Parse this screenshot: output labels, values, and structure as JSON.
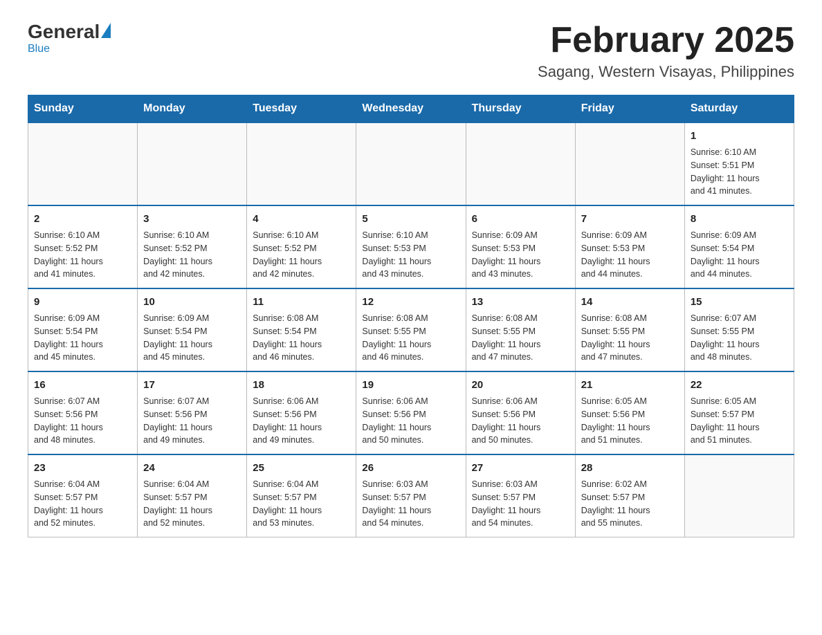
{
  "header": {
    "logo_general": "General",
    "logo_blue": "Blue",
    "month_title": "February 2025",
    "location": "Sagang, Western Visayas, Philippines"
  },
  "weekdays": [
    "Sunday",
    "Monday",
    "Tuesday",
    "Wednesday",
    "Thursday",
    "Friday",
    "Saturday"
  ],
  "weeks": [
    [
      {
        "day": "",
        "info": ""
      },
      {
        "day": "",
        "info": ""
      },
      {
        "day": "",
        "info": ""
      },
      {
        "day": "",
        "info": ""
      },
      {
        "day": "",
        "info": ""
      },
      {
        "day": "",
        "info": ""
      },
      {
        "day": "1",
        "info": "Sunrise: 6:10 AM\nSunset: 5:51 PM\nDaylight: 11 hours\nand 41 minutes."
      }
    ],
    [
      {
        "day": "2",
        "info": "Sunrise: 6:10 AM\nSunset: 5:52 PM\nDaylight: 11 hours\nand 41 minutes."
      },
      {
        "day": "3",
        "info": "Sunrise: 6:10 AM\nSunset: 5:52 PM\nDaylight: 11 hours\nand 42 minutes."
      },
      {
        "day": "4",
        "info": "Sunrise: 6:10 AM\nSunset: 5:52 PM\nDaylight: 11 hours\nand 42 minutes."
      },
      {
        "day": "5",
        "info": "Sunrise: 6:10 AM\nSunset: 5:53 PM\nDaylight: 11 hours\nand 43 minutes."
      },
      {
        "day": "6",
        "info": "Sunrise: 6:09 AM\nSunset: 5:53 PM\nDaylight: 11 hours\nand 43 minutes."
      },
      {
        "day": "7",
        "info": "Sunrise: 6:09 AM\nSunset: 5:53 PM\nDaylight: 11 hours\nand 44 minutes."
      },
      {
        "day": "8",
        "info": "Sunrise: 6:09 AM\nSunset: 5:54 PM\nDaylight: 11 hours\nand 44 minutes."
      }
    ],
    [
      {
        "day": "9",
        "info": "Sunrise: 6:09 AM\nSunset: 5:54 PM\nDaylight: 11 hours\nand 45 minutes."
      },
      {
        "day": "10",
        "info": "Sunrise: 6:09 AM\nSunset: 5:54 PM\nDaylight: 11 hours\nand 45 minutes."
      },
      {
        "day": "11",
        "info": "Sunrise: 6:08 AM\nSunset: 5:54 PM\nDaylight: 11 hours\nand 46 minutes."
      },
      {
        "day": "12",
        "info": "Sunrise: 6:08 AM\nSunset: 5:55 PM\nDaylight: 11 hours\nand 46 minutes."
      },
      {
        "day": "13",
        "info": "Sunrise: 6:08 AM\nSunset: 5:55 PM\nDaylight: 11 hours\nand 47 minutes."
      },
      {
        "day": "14",
        "info": "Sunrise: 6:08 AM\nSunset: 5:55 PM\nDaylight: 11 hours\nand 47 minutes."
      },
      {
        "day": "15",
        "info": "Sunrise: 6:07 AM\nSunset: 5:55 PM\nDaylight: 11 hours\nand 48 minutes."
      }
    ],
    [
      {
        "day": "16",
        "info": "Sunrise: 6:07 AM\nSunset: 5:56 PM\nDaylight: 11 hours\nand 48 minutes."
      },
      {
        "day": "17",
        "info": "Sunrise: 6:07 AM\nSunset: 5:56 PM\nDaylight: 11 hours\nand 49 minutes."
      },
      {
        "day": "18",
        "info": "Sunrise: 6:06 AM\nSunset: 5:56 PM\nDaylight: 11 hours\nand 49 minutes."
      },
      {
        "day": "19",
        "info": "Sunrise: 6:06 AM\nSunset: 5:56 PM\nDaylight: 11 hours\nand 50 minutes."
      },
      {
        "day": "20",
        "info": "Sunrise: 6:06 AM\nSunset: 5:56 PM\nDaylight: 11 hours\nand 50 minutes."
      },
      {
        "day": "21",
        "info": "Sunrise: 6:05 AM\nSunset: 5:56 PM\nDaylight: 11 hours\nand 51 minutes."
      },
      {
        "day": "22",
        "info": "Sunrise: 6:05 AM\nSunset: 5:57 PM\nDaylight: 11 hours\nand 51 minutes."
      }
    ],
    [
      {
        "day": "23",
        "info": "Sunrise: 6:04 AM\nSunset: 5:57 PM\nDaylight: 11 hours\nand 52 minutes."
      },
      {
        "day": "24",
        "info": "Sunrise: 6:04 AM\nSunset: 5:57 PM\nDaylight: 11 hours\nand 52 minutes."
      },
      {
        "day": "25",
        "info": "Sunrise: 6:04 AM\nSunset: 5:57 PM\nDaylight: 11 hours\nand 53 minutes."
      },
      {
        "day": "26",
        "info": "Sunrise: 6:03 AM\nSunset: 5:57 PM\nDaylight: 11 hours\nand 54 minutes."
      },
      {
        "day": "27",
        "info": "Sunrise: 6:03 AM\nSunset: 5:57 PM\nDaylight: 11 hours\nand 54 minutes."
      },
      {
        "day": "28",
        "info": "Sunrise: 6:02 AM\nSunset: 5:57 PM\nDaylight: 11 hours\nand 55 minutes."
      },
      {
        "day": "",
        "info": ""
      }
    ]
  ]
}
